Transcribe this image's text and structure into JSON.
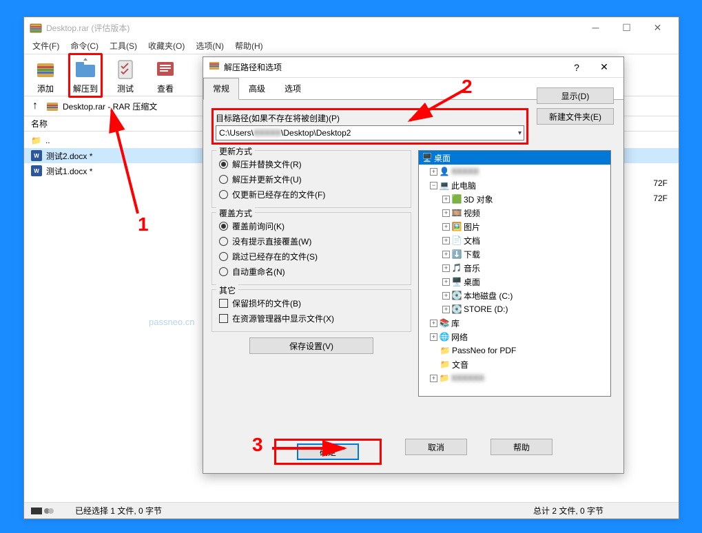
{
  "main_window": {
    "title": "Desktop.rar (评估版本)"
  },
  "menu": {
    "file": "文件(F)",
    "commands": "命令(C)",
    "tools": "工具(S)",
    "favorites": "收藏夹(O)",
    "options": "选项(N)",
    "help": "帮助(H)"
  },
  "toolbar": {
    "add": "添加",
    "extract_to": "解压到",
    "test": "测试",
    "view": "查看"
  },
  "nav": {
    "path": "Desktop.rar - RAR 压缩文"
  },
  "columns": {
    "name": "名称"
  },
  "files": {
    "up": "..",
    "f1": "测试2.docx *",
    "f2": "测试1.docx *"
  },
  "right_info": {
    "r1": "72F",
    "r2": "72F"
  },
  "status": {
    "left": "已经选择 1 文件, 0 字节",
    "right": "总计 2 文件, 0 字节"
  },
  "dialog": {
    "title": "解压路径和选项",
    "tabs": {
      "general": "常规",
      "advanced": "高级",
      "options": "选项"
    },
    "path_label": "目标路径(如果不存在将被创建)(P)",
    "path_pre": "C:\\Users\\",
    "path_hidden": "XXXXX",
    "path_post": "\\Desktop\\Desktop2",
    "side": {
      "display": "显示(D)",
      "new_folder": "新建文件夹(E)"
    },
    "update_title": "更新方式",
    "update": {
      "r1": "解压并替换文件(R)",
      "r2": "解压并更新文件(U)",
      "r3": "仅更新已经存在的文件(F)"
    },
    "overwrite_title": "覆盖方式",
    "overwrite": {
      "r1": "覆盖前询问(K)",
      "r2": "没有提示直接覆盖(W)",
      "r3": "跳过已经存在的文件(S)",
      "r4": "自动重命名(N)"
    },
    "other_title": "其它",
    "other": {
      "c1": "保留损坏的文件(B)",
      "c2": "在资源管理器中显示文件(X)"
    },
    "save_settings": "保存设置(V)",
    "tree": {
      "desktop": "桌面",
      "user_hidden": "XXXXX",
      "thispc": "此电脑",
      "obj3d": "3D 对象",
      "video": "视频",
      "pictures": "图片",
      "documents": "文档",
      "downloads": "下载",
      "music": "音乐",
      "desk2": "桌面",
      "diskc": "本地磁盘 (C:)",
      "diskd": "STORE (D:)",
      "lib": "库",
      "network": "网络",
      "passneo": "PassNeo for PDF",
      "wenyin": "文音",
      "hidden2": "XXXXXX"
    },
    "buttons": {
      "ok": "确定",
      "cancel": "取消",
      "help": "帮助"
    }
  },
  "annotations": {
    "n1": "1",
    "n2": "2",
    "n3": "3"
  },
  "watermark": "passneo.cn"
}
